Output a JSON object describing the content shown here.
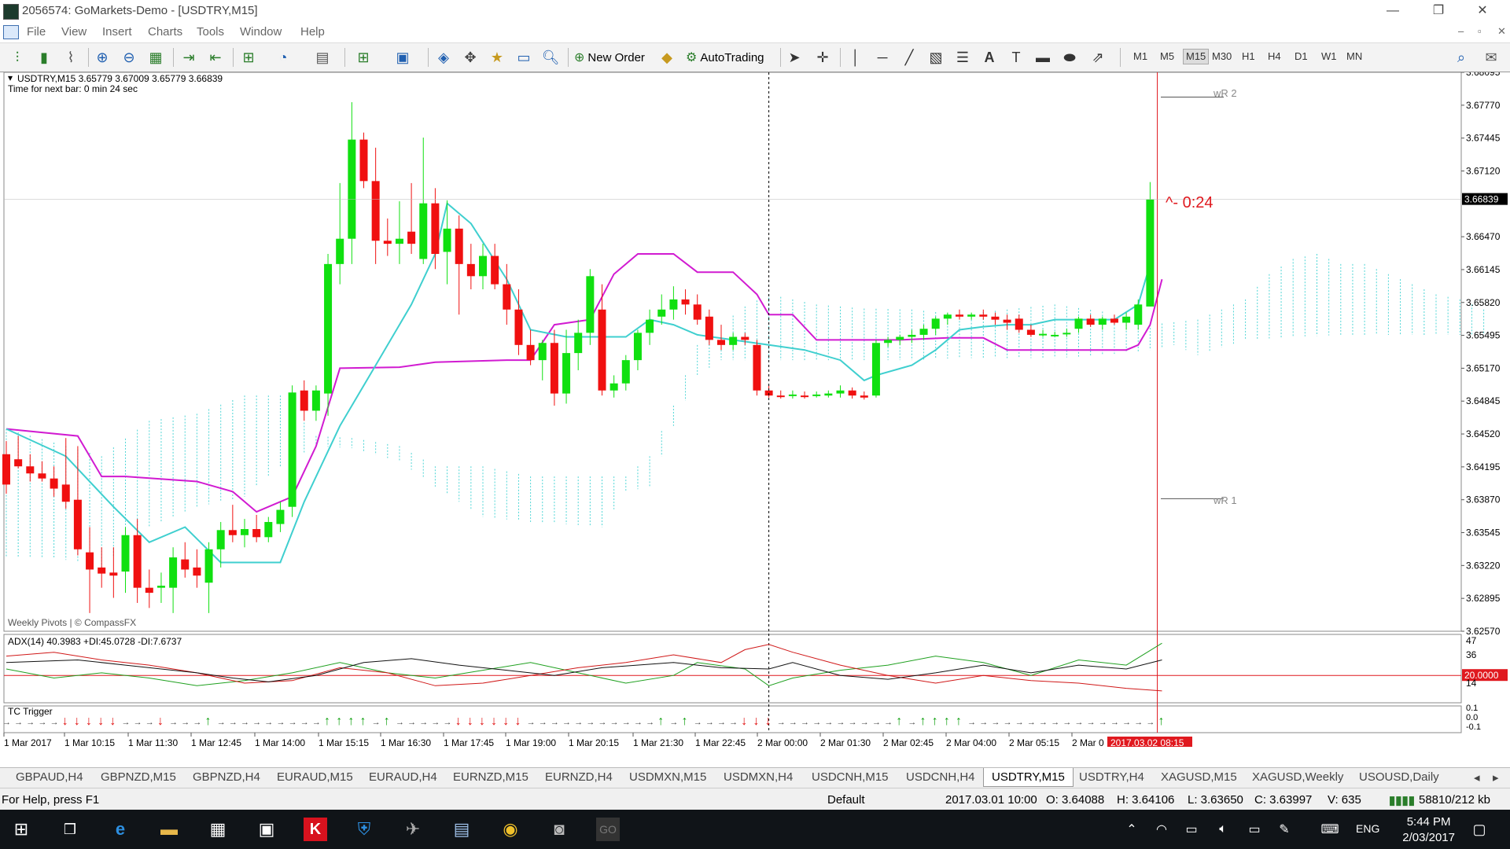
{
  "window": {
    "title": "2056574: GoMarkets-Demo - [USDTRY,M15]"
  },
  "menu": [
    "File",
    "View",
    "Insert",
    "Charts",
    "Tools",
    "Window",
    "Help"
  ],
  "toolbar": {
    "new_order": "New Order",
    "autotrading": "AutoTrading",
    "timeframes": [
      "M1",
      "M5",
      "M15",
      "M30",
      "H1",
      "H4",
      "D1",
      "W1",
      "MN"
    ],
    "active_timeframe": "M15"
  },
  "chart": {
    "info_line": "USDTRY,M15  3.65779 3.67009 3.65779 3.66839",
    "next_bar": "Time for next bar: 0 min 24 sec",
    "countdown": "^- 0:24",
    "watermark": "Weekly Pivots | © CompassFX",
    "current_price": "3.66839",
    "pivot_r2": "wR 2",
    "pivot_r1": "wR 1",
    "price_ticks": [
      "3.68095",
      "3.67770",
      "3.67445",
      "3.67120",
      "3.66470",
      "3.66145",
      "3.65820",
      "3.65495",
      "3.65170",
      "3.64845",
      "3.64520",
      "3.64195",
      "3.63870",
      "3.63545",
      "3.63220",
      "3.62895",
      "3.62570"
    ],
    "time_labels": [
      "1 Mar 2017",
      "1 Mar 10:15",
      "1 Mar 11:30",
      "1 Mar 12:45",
      "1 Mar 14:00",
      "1 Mar 15:15",
      "1 Mar 16:30",
      "1 Mar 17:45",
      "1 Mar 19:00",
      "1 Mar 20:15",
      "1 Mar 21:30",
      "1 Mar 22:45",
      "2 Mar 00:00",
      "2 Mar 01:30",
      "2 Mar 02:45",
      "2 Mar 04:00",
      "2 Mar 05:15",
      "2 Mar 0"
    ],
    "cursor_time": "2017.03.02 08:15"
  },
  "adx": {
    "label": "ADX(14) 40.3983 +DI:45.0728 -DI:7.6737",
    "ticks": [
      "47",
      "36",
      "14"
    ],
    "level": "20.0000"
  },
  "tc": {
    "label": "TC Trigger",
    "ticks": [
      "0.1",
      "0.0",
      "-0.1"
    ]
  },
  "chart_data": {
    "type": "candlestick",
    "title": "USDTRY,M15",
    "ylim": [
      3.6257,
      3.68095
    ],
    "candles": [
      {
        "o": 3.6432,
        "h": 3.6445,
        "l": 3.6393,
        "c": 3.6402
      },
      {
        "o": 3.6427,
        "h": 3.645,
        "l": 3.6418,
        "c": 3.642
      },
      {
        "o": 3.642,
        "h": 3.6432,
        "l": 3.6405,
        "c": 3.6413
      },
      {
        "o": 3.6413,
        "h": 3.6425,
        "l": 3.6405,
        "c": 3.6408
      },
      {
        "o": 3.6408,
        "h": 3.642,
        "l": 3.639,
        "c": 3.6398
      },
      {
        "o": 3.6402,
        "h": 3.6448,
        "l": 3.6378,
        "c": 3.6385
      },
      {
        "o": 3.6387,
        "h": 3.644,
        "l": 3.6332,
        "c": 3.6338
      },
      {
        "o": 3.6335,
        "h": 3.636,
        "l": 3.6275,
        "c": 3.6318
      },
      {
        "o": 3.632,
        "h": 3.634,
        "l": 3.63,
        "c": 3.6314
      },
      {
        "o": 3.6315,
        "h": 3.634,
        "l": 3.629,
        "c": 3.6312
      },
      {
        "o": 3.6316,
        "h": 3.636,
        "l": 3.6295,
        "c": 3.6352
      },
      {
        "o": 3.6352,
        "h": 3.6368,
        "l": 3.6285,
        "c": 3.63
      },
      {
        "o": 3.63,
        "h": 3.6318,
        "l": 3.628,
        "c": 3.6295
      },
      {
        "o": 3.63,
        "h": 3.6315,
        "l": 3.6285,
        "c": 3.6302
      },
      {
        "o": 3.63,
        "h": 3.634,
        "l": 3.6275,
        "c": 3.633
      },
      {
        "o": 3.6328,
        "h": 3.6345,
        "l": 3.631,
        "c": 3.6318
      },
      {
        "o": 3.632,
        "h": 3.6338,
        "l": 3.63,
        "c": 3.6312
      },
      {
        "o": 3.6305,
        "h": 3.6345,
        "l": 3.6275,
        "c": 3.6338
      },
      {
        "o": 3.6338,
        "h": 3.6365,
        "l": 3.632,
        "c": 3.6357
      },
      {
        "o": 3.6357,
        "h": 3.6382,
        "l": 3.6345,
        "c": 3.6352
      },
      {
        "o": 3.6352,
        "h": 3.6368,
        "l": 3.634,
        "c": 3.6358
      },
      {
        "o": 3.6358,
        "h": 3.6372,
        "l": 3.6345,
        "c": 3.635
      },
      {
        "o": 3.635,
        "h": 3.637,
        "l": 3.6345,
        "c": 3.6365
      },
      {
        "o": 3.6363,
        "h": 3.6385,
        "l": 3.6355,
        "c": 3.6377
      },
      {
        "o": 3.638,
        "h": 3.65,
        "l": 3.637,
        "c": 3.6493
      },
      {
        "o": 3.6495,
        "h": 3.6505,
        "l": 3.6465,
        "c": 3.6475
      },
      {
        "o": 3.6475,
        "h": 3.65,
        "l": 3.6465,
        "c": 3.6495
      },
      {
        "o": 3.6492,
        "h": 3.663,
        "l": 3.647,
        "c": 3.662
      },
      {
        "o": 3.662,
        "h": 3.67,
        "l": 3.66,
        "c": 3.6645
      },
      {
        "o": 3.6645,
        "h": 3.678,
        "l": 3.662,
        "c": 3.6743
      },
      {
        "o": 3.6743,
        "h": 3.675,
        "l": 3.6695,
        "c": 3.6702
      },
      {
        "o": 3.6702,
        "h": 3.6735,
        "l": 3.662,
        "c": 3.6643
      },
      {
        "o": 3.6643,
        "h": 3.6665,
        "l": 3.6628,
        "c": 3.664
      },
      {
        "o": 3.664,
        "h": 3.6682,
        "l": 3.662,
        "c": 3.6645
      },
      {
        "o": 3.6652,
        "h": 3.67,
        "l": 3.663,
        "c": 3.664
      },
      {
        "o": 3.6625,
        "h": 3.6745,
        "l": 3.662,
        "c": 3.668
      },
      {
        "o": 3.668,
        "h": 3.6695,
        "l": 3.6615,
        "c": 3.663
      },
      {
        "o": 3.6632,
        "h": 3.6683,
        "l": 3.66,
        "c": 3.6655
      },
      {
        "o": 3.6655,
        "h": 3.6668,
        "l": 3.657,
        "c": 3.662
      },
      {
        "o": 3.662,
        "h": 3.664,
        "l": 3.6595,
        "c": 3.6608
      },
      {
        "o": 3.6608,
        "h": 3.664,
        "l": 3.6595,
        "c": 3.6628
      },
      {
        "o": 3.6628,
        "h": 3.664,
        "l": 3.6595,
        "c": 3.66
      },
      {
        "o": 3.66,
        "h": 3.662,
        "l": 3.656,
        "c": 3.6575
      },
      {
        "o": 3.6575,
        "h": 3.6595,
        "l": 3.653,
        "c": 3.654
      },
      {
        "o": 3.654,
        "h": 3.6555,
        "l": 3.652,
        "c": 3.6525
      },
      {
        "o": 3.6525,
        "h": 3.6545,
        "l": 3.6505,
        "c": 3.6542
      },
      {
        "o": 3.6542,
        "h": 3.6555,
        "l": 3.648,
        "c": 3.6492
      },
      {
        "o": 3.6492,
        "h": 3.6555,
        "l": 3.6482,
        "c": 3.6532
      },
      {
        "o": 3.6532,
        "h": 3.6565,
        "l": 3.6515,
        "c": 3.6552
      },
      {
        "o": 3.6552,
        "h": 3.6615,
        "l": 3.654,
        "c": 3.6608
      },
      {
        "o": 3.6575,
        "h": 3.66,
        "l": 3.649,
        "c": 3.6495
      },
      {
        "o": 3.6495,
        "h": 3.651,
        "l": 3.6488,
        "c": 3.6502
      },
      {
        "o": 3.6502,
        "h": 3.653,
        "l": 3.6495,
        "c": 3.6525
      },
      {
        "o": 3.6525,
        "h": 3.6555,
        "l": 3.6515,
        "c": 3.6552
      },
      {
        "o": 3.6552,
        "h": 3.6575,
        "l": 3.654,
        "c": 3.6565
      },
      {
        "o": 3.6568,
        "h": 3.659,
        "l": 3.656,
        "c": 3.6575
      },
      {
        "o": 3.6575,
        "h": 3.6598,
        "l": 3.6565,
        "c": 3.6585
      },
      {
        "o": 3.6585,
        "h": 3.6595,
        "l": 3.657,
        "c": 3.658
      },
      {
        "o": 3.658,
        "h": 3.659,
        "l": 3.656,
        "c": 3.6565
      },
      {
        "o": 3.6568,
        "h": 3.6575,
        "l": 3.654,
        "c": 3.6545
      },
      {
        "o": 3.6545,
        "h": 3.656,
        "l": 3.6535,
        "c": 3.654
      },
      {
        "o": 3.654,
        "h": 3.6552,
        "l": 3.6535,
        "c": 3.6548
      },
      {
        "o": 3.6548,
        "h": 3.6552,
        "l": 3.654,
        "c": 3.6545
      },
      {
        "o": 3.654,
        "h": 3.6545,
        "l": 3.649,
        "c": 3.6495
      },
      {
        "o": 3.6495,
        "h": 3.65,
        "l": 3.6488,
        "c": 3.649
      },
      {
        "o": 3.649,
        "h": 3.6495,
        "l": 3.6487,
        "c": 3.6489
      },
      {
        "o": 3.649,
        "h": 3.6495,
        "l": 3.6487,
        "c": 3.6491
      },
      {
        "o": 3.649,
        "h": 3.6494,
        "l": 3.6487,
        "c": 3.6489
      },
      {
        "o": 3.649,
        "h": 3.6494,
        "l": 3.6488,
        "c": 3.6491
      },
      {
        "o": 3.649,
        "h": 3.6495,
        "l": 3.6488,
        "c": 3.6492
      },
      {
        "o": 3.6492,
        "h": 3.65,
        "l": 3.6488,
        "c": 3.6495
      },
      {
        "o": 3.6495,
        "h": 3.6498,
        "l": 3.6487,
        "c": 3.649
      },
      {
        "o": 3.649,
        "h": 3.6494,
        "l": 3.6486,
        "c": 3.6488
      },
      {
        "o": 3.649,
        "h": 3.6545,
        "l": 3.6488,
        "c": 3.6542
      },
      {
        "o": 3.6542,
        "h": 3.6548,
        "l": 3.6538,
        "c": 3.6545
      },
      {
        "o": 3.6545,
        "h": 3.655,
        "l": 3.654,
        "c": 3.6548
      },
      {
        "o": 3.6548,
        "h": 3.6555,
        "l": 3.6542,
        "c": 3.655
      },
      {
        "o": 3.655,
        "h": 3.656,
        "l": 3.6545,
        "c": 3.6556
      },
      {
        "o": 3.6556,
        "h": 3.6568,
        "l": 3.655,
        "c": 3.6566
      },
      {
        "o": 3.6566,
        "h": 3.6572,
        "l": 3.656,
        "c": 3.657
      },
      {
        "o": 3.657,
        "h": 3.6575,
        "l": 3.6565,
        "c": 3.6568
      },
      {
        "o": 3.6568,
        "h": 3.6572,
        "l": 3.6565,
        "c": 3.657
      },
      {
        "o": 3.657,
        "h": 3.6575,
        "l": 3.6565,
        "c": 3.6568
      },
      {
        "o": 3.6568,
        "h": 3.6572,
        "l": 3.656,
        "c": 3.6565
      },
      {
        "o": 3.6565,
        "h": 3.657,
        "l": 3.6555,
        "c": 3.6562
      },
      {
        "o": 3.6566,
        "h": 3.657,
        "l": 3.6552,
        "c": 3.6555
      },
      {
        "o": 3.6555,
        "h": 3.656,
        "l": 3.6548,
        "c": 3.655
      },
      {
        "o": 3.655,
        "h": 3.6555,
        "l": 3.6548,
        "c": 3.6551
      },
      {
        "o": 3.655,
        "h": 3.6553,
        "l": 3.6548,
        "c": 3.655
      },
      {
        "o": 3.6551,
        "h": 3.6556,
        "l": 3.6548,
        "c": 3.6552
      },
      {
        "o": 3.6556,
        "h": 3.6568,
        "l": 3.6552,
        "c": 3.6566
      },
      {
        "o": 3.6566,
        "h": 3.657,
        "l": 3.6558,
        "c": 3.656
      },
      {
        "o": 3.656,
        "h": 3.6568,
        "l": 3.6555,
        "c": 3.6566
      },
      {
        "o": 3.6566,
        "h": 3.657,
        "l": 3.656,
        "c": 3.6562
      },
      {
        "o": 3.6562,
        "h": 3.6572,
        "l": 3.6555,
        "c": 3.6568
      },
      {
        "o": 3.656,
        "h": 3.6585,
        "l": 3.6555,
        "c": 3.658
      },
      {
        "o": 3.6578,
        "h": 3.6701,
        "l": 3.6578,
        "c": 3.6684
      }
    ],
    "tenkan": [
      [
        0,
        3.6457
      ],
      [
        5,
        3.643
      ],
      [
        9,
        3.638
      ],
      [
        12,
        3.6345
      ],
      [
        15,
        3.636
      ],
      [
        18,
        3.6325
      ],
      [
        23,
        3.6325
      ],
      [
        25,
        3.6385
      ],
      [
        28,
        3.646
      ],
      [
        31,
        3.652
      ],
      [
        34,
        3.658
      ],
      [
        36,
        3.663
      ],
      [
        37,
        3.668
      ],
      [
        39,
        3.666
      ],
      [
        42,
        3.6605
      ],
      [
        44,
        3.6555
      ],
      [
        47,
        3.6548
      ],
      [
        50,
        3.6548
      ],
      [
        52,
        3.6548
      ],
      [
        54,
        3.6565
      ],
      [
        56,
        3.656
      ],
      [
        58,
        3.655
      ],
      [
        61,
        3.6545
      ],
      [
        64,
        3.654
      ],
      [
        67,
        3.6535
      ],
      [
        70,
        3.6525
      ],
      [
        72,
        3.6505
      ],
      [
        73,
        3.651
      ],
      [
        76,
        3.652
      ],
      [
        78,
        3.6535
      ],
      [
        80,
        3.6555
      ],
      [
        82,
        3.6558
      ],
      [
        84,
        3.656
      ],
      [
        86,
        3.656
      ],
      [
        88,
        3.6565
      ],
      [
        90,
        3.6565
      ],
      [
        93,
        3.6565
      ],
      [
        95,
        3.658
      ],
      [
        96,
        3.662
      ]
    ],
    "kijun": [
      [
        0,
        3.6457
      ],
      [
        6,
        3.645
      ],
      [
        8,
        3.641
      ],
      [
        10,
        3.641
      ],
      [
        16,
        3.6405
      ],
      [
        19,
        3.6395
      ],
      [
        21,
        3.6375
      ],
      [
        24,
        3.639
      ],
      [
        26,
        3.644
      ],
      [
        28,
        3.6517
      ],
      [
        33,
        3.6518
      ],
      [
        36,
        3.6523
      ],
      [
        42,
        3.6525
      ],
      [
        44,
        3.6525
      ],
      [
        46,
        3.656
      ],
      [
        49,
        3.6565
      ],
      [
        51,
        3.661
      ],
      [
        53,
        3.663
      ],
      [
        56,
        3.663
      ],
      [
        58,
        3.6612
      ],
      [
        61,
        3.6612
      ],
      [
        63,
        3.659
      ],
      [
        64,
        3.657
      ],
      [
        66,
        3.657
      ],
      [
        68,
        3.6545
      ],
      [
        75,
        3.6545
      ],
      [
        79,
        3.6547
      ],
      [
        82,
        3.6547
      ],
      [
        84,
        3.6535
      ],
      [
        86,
        3.6535
      ],
      [
        91,
        3.6535
      ],
      [
        94,
        3.6535
      ],
      [
        95,
        3.654
      ],
      [
        96,
        3.656
      ],
      [
        97,
        3.6605
      ]
    ],
    "pivots": {
      "wR2": 3.6785,
      "wR1": 3.6388
    }
  }
}
